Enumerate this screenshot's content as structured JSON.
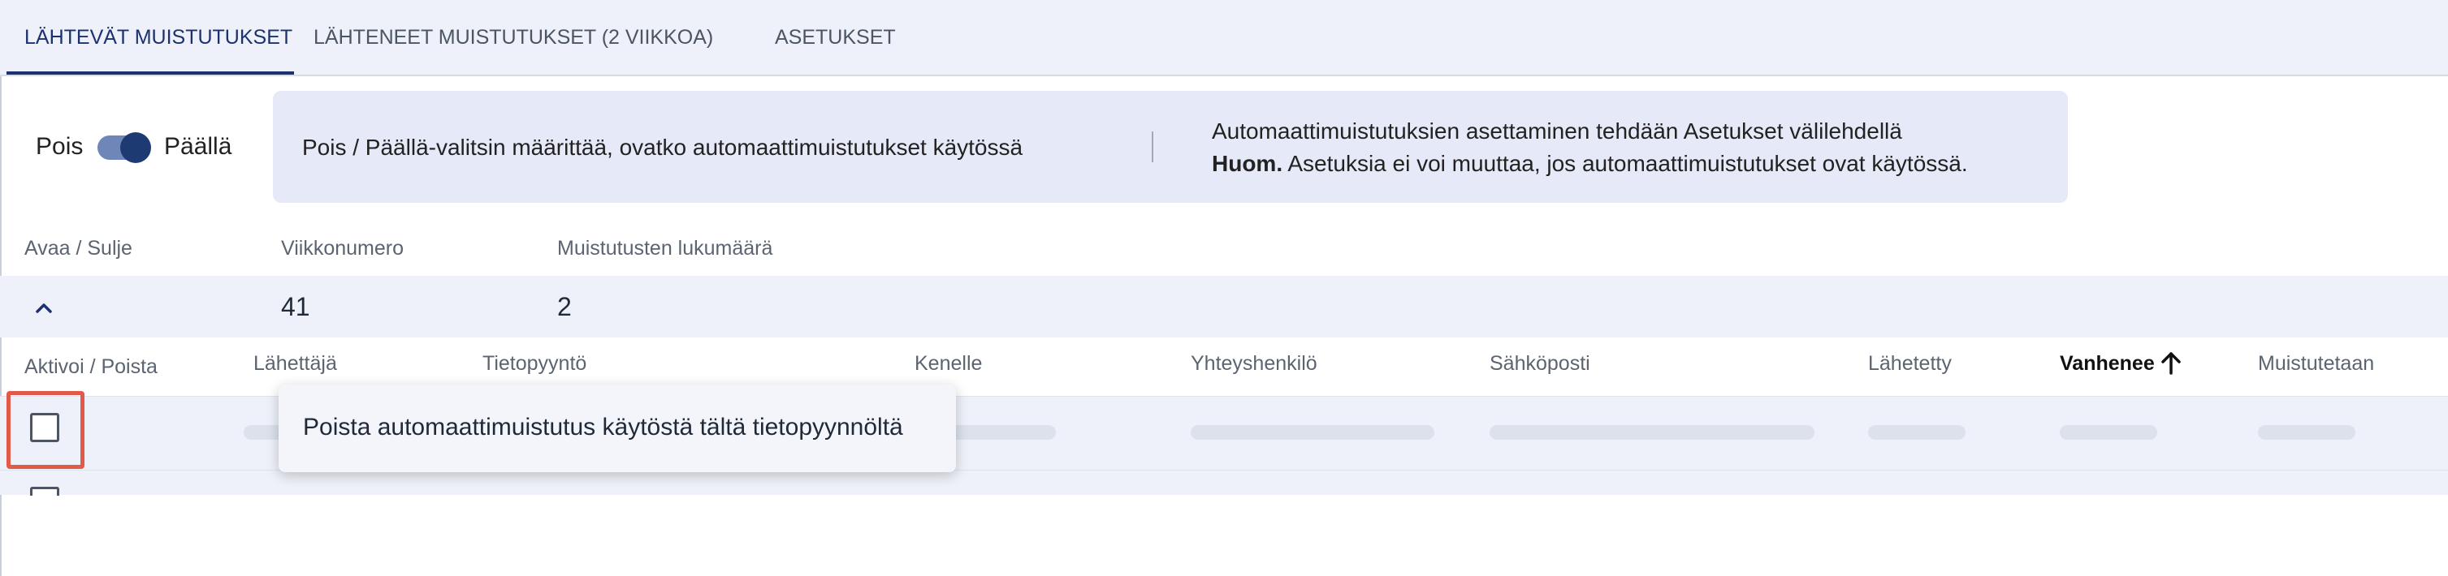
{
  "tabs": [
    {
      "label": "LÄHTEVÄT MUISTUTUKSET",
      "active": true
    },
    {
      "label": "LÄHTENEET MUISTUTUKSET (2 VIIKKOA)",
      "active": false
    },
    {
      "label": "ASETUKSET",
      "active": false
    }
  ],
  "toggle": {
    "off_label": "Pois",
    "on_label": "Päällä",
    "state": "on"
  },
  "info": {
    "left_text": "Pois / Päällä-valitsin määrittää, ovatko automaattimuistutukset käytössä",
    "right_line1": "Automaattimuistutuksien asettaminen tehdään Asetukset välilehdellä",
    "right_line2_bold": "Huom.",
    "right_line2_rest": " Asetuksia ei voi muuttaa, jos automaattimuistutukset ovat käytössä."
  },
  "group": {
    "headers": {
      "toggle": "Avaa / Sulje",
      "week": "Viikkonumero",
      "count": "Muistutusten lukumäärä"
    },
    "week_value": "41",
    "count_value": "2"
  },
  "table": {
    "columns": {
      "activate": "Aktivoi / Poista",
      "sender": "Lähettäjä",
      "request": "Tietopyyntö",
      "recipient": "Kenelle",
      "contact": "Yhteyshenkilö",
      "email": "Sähköposti",
      "sent": "Lähetetty",
      "expires": "Vanhenee",
      "reminded": "Muistutetaan"
    },
    "sort": {
      "column": "expires",
      "direction": "ascending"
    }
  },
  "tooltip": {
    "text": "Poista automaattimuistutus käytöstä tältä tietopyynnöltä"
  },
  "colors": {
    "accent": "#1c3270",
    "highlight": "#e45a4a",
    "band": "#eef1f9"
  }
}
